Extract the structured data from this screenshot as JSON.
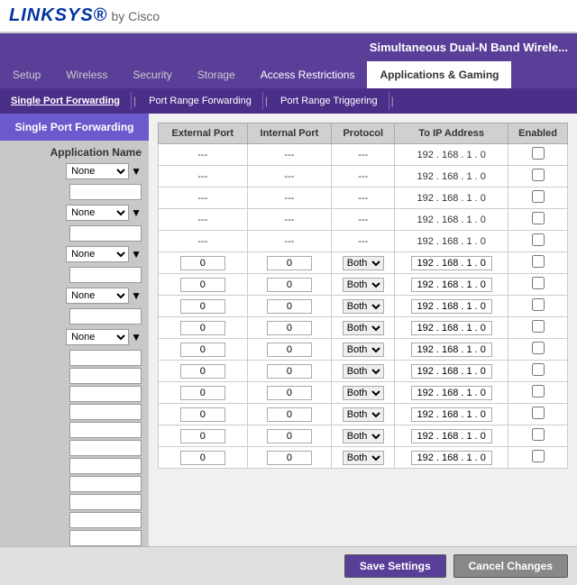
{
  "header": {
    "logo": "LINKSYS",
    "by": "by Cisco"
  },
  "topnav": {
    "title": "Simultaneous Dual-N Band Wirele..."
  },
  "main_nav": {
    "tabs": [
      {
        "label": "Setup",
        "active": false
      },
      {
        "label": "Wireless",
        "active": false
      },
      {
        "label": "Security",
        "active": false
      },
      {
        "label": "Storage",
        "active": false
      },
      {
        "label": "Access Restrictions",
        "active": false
      },
      {
        "label": "Applications & Gaming",
        "active": true
      }
    ]
  },
  "sub_nav": {
    "items": [
      {
        "label": "Single Port Forwarding",
        "active": true
      },
      {
        "label": "Port Range Forwarding",
        "active": false
      },
      {
        "label": "Port Range Triggering",
        "active": false
      }
    ]
  },
  "sidebar": {
    "title": "Single Port Forwarding",
    "col_label": "Application Name",
    "rows": [
      {
        "select": "None",
        "input": ""
      },
      {
        "select": "None",
        "input": ""
      },
      {
        "select": "None",
        "input": ""
      },
      {
        "select": "None",
        "input": ""
      },
      {
        "select": "None",
        "input": ""
      }
    ],
    "extra_inputs": [
      "",
      "",
      "",
      "",
      "",
      "",
      "",
      "",
      "",
      ""
    ]
  },
  "table": {
    "headers": [
      "External Port",
      "Internal Port",
      "Protocol",
      "To IP Address",
      "Enabled"
    ],
    "dash_rows": 5,
    "input_rows": [
      {
        "ext": "0",
        "int": "0",
        "proto": "Both",
        "ip": "192 . 168 . 1 . 0",
        "enabled": false
      },
      {
        "ext": "0",
        "int": "0",
        "proto": "Both",
        "ip": "192 . 168 . 1 . 0",
        "enabled": false
      },
      {
        "ext": "0",
        "int": "0",
        "proto": "Both",
        "ip": "192 . 168 . 1 . 0",
        "enabled": false
      },
      {
        "ext": "0",
        "int": "0",
        "proto": "Both",
        "ip": "192 . 168 . 1 . 0",
        "enabled": false
      },
      {
        "ext": "0",
        "int": "0",
        "proto": "Both",
        "ip": "192 . 168 . 1 . 0",
        "enabled": false
      },
      {
        "ext": "0",
        "int": "0",
        "proto": "Both",
        "ip": "192 . 168 . 1 . 0",
        "enabled": false
      },
      {
        "ext": "0",
        "int": "0",
        "proto": "Both",
        "ip": "192 . 168 . 1 . 0",
        "enabled": false
      },
      {
        "ext": "0",
        "int": "0",
        "proto": "Both",
        "ip": "192 . 168 . 1 . 0",
        "enabled": false
      },
      {
        "ext": "0",
        "int": "0",
        "proto": "Both",
        "ip": "192 . 168 . 1 . 0",
        "enabled": false
      },
      {
        "ext": "0",
        "int": "0",
        "proto": "Both",
        "ip": "192 . 168 . 1 . 0",
        "enabled": false
      }
    ]
  },
  "footer": {
    "save_label": "Save Settings",
    "cancel_label": "Cancel Changes"
  }
}
